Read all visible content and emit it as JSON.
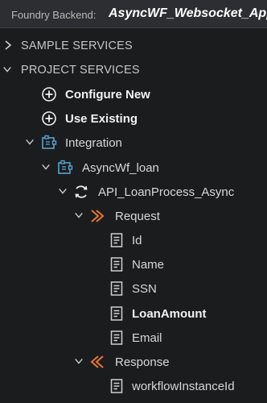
{
  "header": {
    "label": "Foundry Backend:",
    "app_name": "AsyncWF_Websocket_App"
  },
  "sections": {
    "sample": {
      "label": "SAMPLE SERVICES",
      "expanded": false
    },
    "project": {
      "label": "PROJECT SERVICES",
      "expanded": true
    }
  },
  "actions": {
    "configure_new": "Configure New",
    "use_existing": "Use Existing"
  },
  "tree": {
    "integration": "Integration",
    "service": "AsyncWf_loan",
    "operation": "API_LoanProcess_Async",
    "request": "Request",
    "request_fields": [
      "Id",
      "Name",
      "SSN",
      "LoanAmount",
      "Email"
    ],
    "response": "Response",
    "response_fields": [
      "workflowInstanceId"
    ]
  },
  "colors": {
    "accent_orange": "#e8762c",
    "icon_blue": "#5fa9d6",
    "background": "#1b1c1e"
  }
}
